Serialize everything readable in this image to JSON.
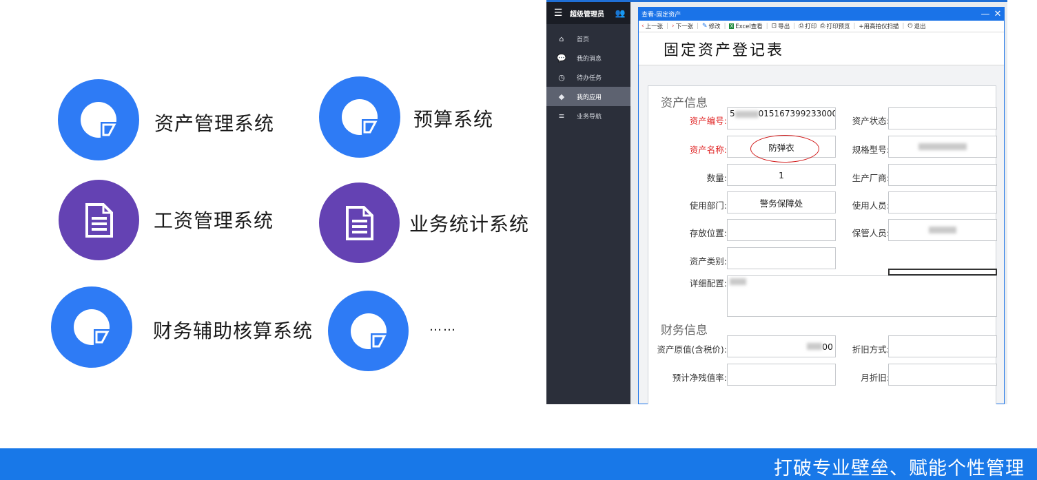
{
  "systems": [
    {
      "label": "资产管理系统",
      "icon": "pie-chart-icon",
      "color": "#2e7bf5"
    },
    {
      "label": "预算系统",
      "icon": "pie-chart-icon",
      "color": "#2e7bf5"
    },
    {
      "label": "工资管理系统",
      "icon": "document-icon",
      "color": "#6442b3"
    },
    {
      "label": "业务统计系统",
      "icon": "document-icon",
      "color": "#6442b3"
    },
    {
      "label": "财务辅助核算系统",
      "icon": "pie-chart-icon",
      "color": "#2e7bf5"
    },
    {
      "label": "……",
      "icon": "pie-chart-icon",
      "color": "#2e7bf5"
    }
  ],
  "app": {
    "sidebar": {
      "user": "超级管理员",
      "items": [
        {
          "label": "首页",
          "icon": "home-icon"
        },
        {
          "label": "我的消息",
          "icon": "message-icon"
        },
        {
          "label": "待办任务",
          "icon": "timer-icon"
        },
        {
          "label": "我的应用",
          "icon": "cube-icon"
        },
        {
          "label": "业务导航",
          "icon": "nav-icon"
        }
      ]
    },
    "window": {
      "title": "查看-固定资产",
      "minimize": "—",
      "close": "✕"
    },
    "toolbar": [
      "上一张",
      "下一张",
      "修改",
      "Excel查看",
      "导出",
      "打印",
      "打印预览",
      "+用高拍仪扫描",
      "退出"
    ],
    "form_title": "固定资产登记表",
    "section_asset": "资产信息",
    "section_finance": "财务信息",
    "fields": {
      "asset_no_label": "资产编号:",
      "asset_no_value": "015167399233000",
      "asset_status_label": "资产状态:",
      "asset_name_label": "资产名称:",
      "asset_name_value": "防弹衣",
      "model_label": "规格型号:",
      "qty_label": "数量:",
      "qty_value": "1",
      "maker_label": "生产厂商:",
      "dept_label": "使用部门:",
      "dept_value": "警务保障处",
      "user_label": "使用人员:",
      "location_label": "存放位置:",
      "keeper_label": "保管人员:",
      "category_label": "资产类别:",
      "detail_label": "详细配置:",
      "orig_value_label": "资产原值(含税价):",
      "orig_value_suffix": "00",
      "depr_method_label": "折旧方式:",
      "residual_label": "预计净残值率:",
      "monthly_depr_label": "月折旧:"
    }
  },
  "banner": "打破专业壁垒、赋能个性管理"
}
